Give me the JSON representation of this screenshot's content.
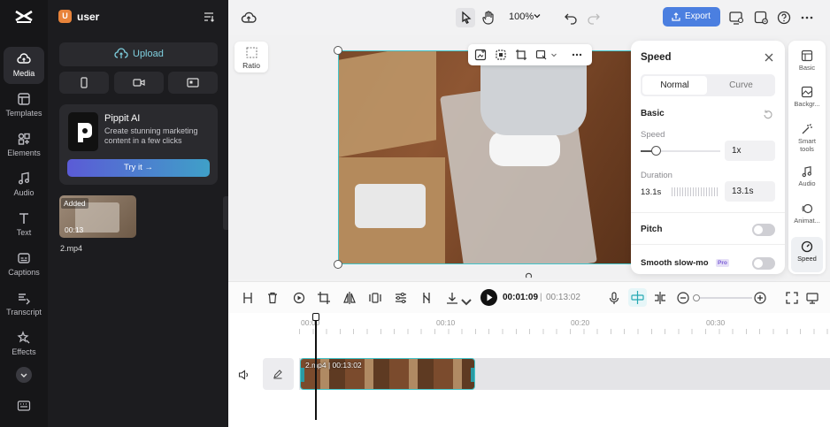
{
  "rail": {
    "items": [
      {
        "label": "Media",
        "icon": "cloud-icon"
      },
      {
        "label": "Templates",
        "icon": "templates-icon"
      },
      {
        "label": "Elements",
        "icon": "elements-icon"
      },
      {
        "label": "Audio",
        "icon": "music-icon"
      },
      {
        "label": "Text",
        "icon": "text-icon"
      },
      {
        "label": "Captions",
        "icon": "captions-icon"
      },
      {
        "label": "Transcript",
        "icon": "transcript-icon"
      },
      {
        "label": "Effects",
        "icon": "effects-icon"
      }
    ]
  },
  "user": {
    "initial": "U",
    "name": "user"
  },
  "media": {
    "upload_label": "Upload",
    "promo": {
      "title": "Pippit AI",
      "text": "Create stunning marketing content in a few clicks",
      "button": "Try it"
    },
    "clip": {
      "badge": "Added",
      "duration": "00:13",
      "filename": "2.mp4"
    }
  },
  "topbar": {
    "zoom": "100%",
    "export_label": "Export"
  },
  "viewer": {
    "ratio_label": "Ratio"
  },
  "speed_panel": {
    "title": "Speed",
    "tabs": [
      "Normal",
      "Curve"
    ],
    "active_tab": "Normal",
    "section_basic": "Basic",
    "speed_label": "Speed",
    "speed_value": "1x",
    "duration_label": "Duration",
    "duration_original": "13.1s",
    "duration_value": "13.1s",
    "pitch_label": "Pitch",
    "smooth_label": "Smooth slow-mo",
    "pro_badge": "Pro"
  },
  "right_rail": {
    "items": [
      {
        "label": "Basic",
        "icon": "basic-icon"
      },
      {
        "label": "Backgr...",
        "icon": "background-icon"
      },
      {
        "label": "Smart tools",
        "icon": "smart-tools-icon"
      },
      {
        "label": "Audio",
        "icon": "audio-icon"
      },
      {
        "label": "Animat...",
        "icon": "animation-icon"
      },
      {
        "label": "Speed",
        "icon": "speed-icon"
      }
    ]
  },
  "playback": {
    "current": "00:01:09",
    "total": "00:13:02"
  },
  "timeline": {
    "ticks": [
      "00:00",
      "00:10",
      "00:20",
      "00:30"
    ],
    "clip_label": "2.mp4 | 00:13:02"
  },
  "colors": {
    "accent": "#3f8fd8",
    "selection": "#42c3c9",
    "primary_button": "#4b7fe0"
  }
}
